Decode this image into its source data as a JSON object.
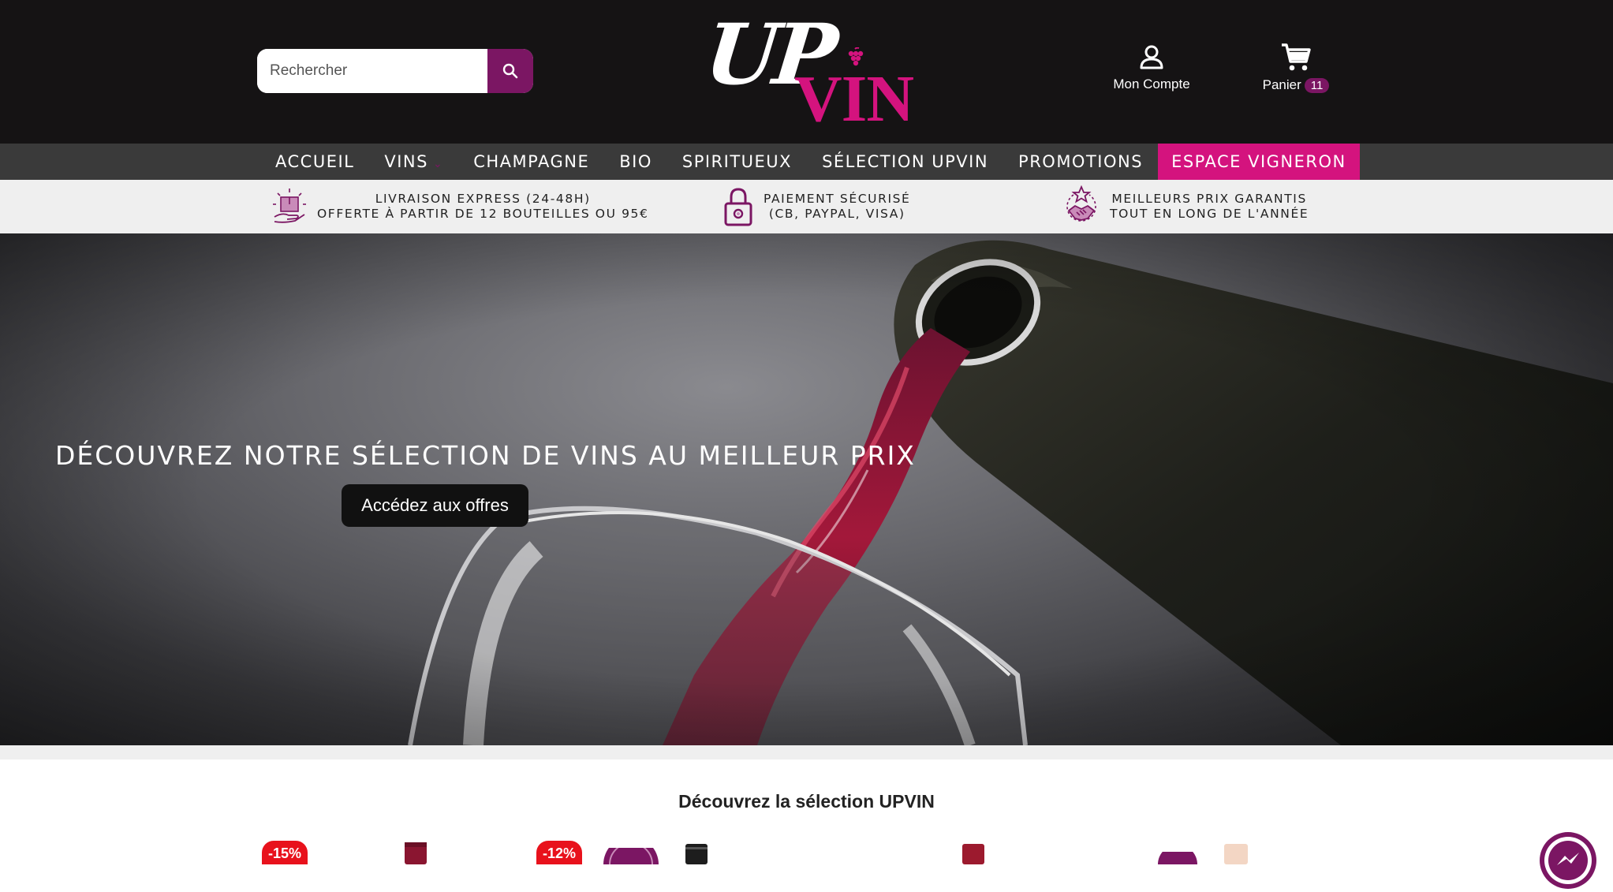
{
  "header": {
    "search": {
      "placeholder": "Rechercher",
      "value": ""
    },
    "logo": {
      "part1": "UP",
      "part2": "VIN"
    },
    "account": {
      "label": "Mon Compte"
    },
    "cart": {
      "label": "Panier",
      "count": "11"
    }
  },
  "nav": {
    "items": [
      {
        "label": "ACCUEIL"
      },
      {
        "label": "VINS"
      },
      {
        "label": "CHAMPAGNE"
      },
      {
        "label": "BIO"
      },
      {
        "label": "SPIRITUEUX"
      },
      {
        "label": "SÉLECTION UPVIN"
      },
      {
        "label": "PROMOTIONS"
      },
      {
        "label": "ESPACE VIGNERON"
      }
    ]
  },
  "benefits": [
    {
      "line1": "LIVRAISON EXPRESS (24-48H)",
      "line2": "OFFERTE À PARTIR DE 12 BOUTEILLES OU 95€",
      "icon": "delivery-box-icon"
    },
    {
      "line1": "PAIEMENT SÉCURISÉ",
      "line2": "(CB, PAYPAL, VISA)",
      "icon": "padlock-icon"
    },
    {
      "line1": "MEILLEURS PRIX GARANTIS",
      "line2": "TOUT EN LONG DE L'ANNÉE",
      "icon": "handshake-star-icon"
    }
  ],
  "hero": {
    "title": "DÉCOUVREZ NOTRE SÉLECTION DE VINS AU MEILLEUR PRIX",
    "cta": "Accédez aux offres"
  },
  "section": {
    "title": "Découvrez la sélection UPVIN"
  },
  "products": [
    {
      "discount": "-15%"
    },
    {
      "discount": "-12%"
    }
  ],
  "colors": {
    "brand_pink": "#d4137e",
    "brand_purple": "#7b1663",
    "header_bg": "#151314",
    "nav_bg": "#3a3a3a",
    "discount_red": "#e8121c"
  }
}
